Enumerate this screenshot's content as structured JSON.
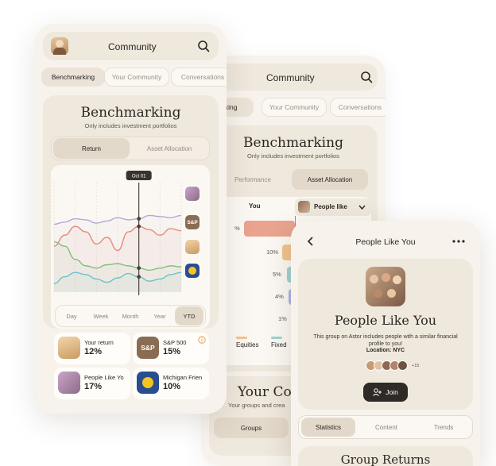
{
  "back": {
    "header": {
      "title": "Community"
    },
    "tabs": [
      {
        "label": "hmarking"
      },
      {
        "label": "Your Community"
      },
      {
        "label": "Conversations"
      }
    ],
    "section": {
      "title": "Benchmarking",
      "subtitle": "Only includes investment portfolios",
      "segments": [
        {
          "label": "Performance"
        },
        {
          "label": "Asset Allocation"
        }
      ]
    },
    "compare": {
      "left_label": "You",
      "right_label": "People like"
    },
    "bars": [
      {
        "pct": "%",
        "color": "#e9a38f"
      },
      {
        "pct": "10%",
        "color": "#f2c38f"
      },
      {
        "pct": "5%",
        "color": "#9fd4d0"
      },
      {
        "pct": "4%",
        "color": "#a9b7e4"
      },
      {
        "pct": "1%",
        "color": "#d9a8c6"
      }
    ],
    "legend": [
      {
        "label": "F",
        "color": "#f2c38f"
      },
      {
        "label": "Equities",
        "color": "#f2c38f"
      },
      {
        "label": "Fixed",
        "color": "#9fd4d0"
      }
    ],
    "community": {
      "title": "Your Co",
      "subtitle": "Your groups and crea",
      "button": "Groups"
    }
  },
  "front": {
    "header": {
      "title": "Community"
    },
    "tabs": [
      {
        "label": "Benchmarking"
      },
      {
        "label": "Your Community"
      },
      {
        "label": "Conversations"
      }
    ],
    "section": {
      "title": "Benchmarking",
      "subtitle": "Only includes investment portfolios",
      "segments": [
        {
          "label": "Return"
        },
        {
          "label": "Asset Allocation"
        }
      ]
    },
    "chart_data": {
      "type": "line",
      "title": "",
      "xlabel": "",
      "ylabel": "",
      "x": [
        0,
        1,
        2,
        3,
        4,
        5,
        6,
        7,
        8,
        9,
        10,
        11,
        12
      ],
      "ylim": [
        0,
        100
      ],
      "marker_label": "Oct 01",
      "grid": true,
      "series": [
        {
          "color": "#b9a4dc",
          "values": [
            62,
            64,
            67,
            66,
            63,
            65,
            68,
            66,
            67,
            70,
            69,
            68,
            70
          ]
        },
        {
          "color": "#e58a7a",
          "values": [
            42,
            52,
            60,
            55,
            44,
            50,
            38,
            55,
            60,
            57,
            52,
            58,
            56
          ]
        },
        {
          "color": "#7fbf7b",
          "values": [
            46,
            42,
            30,
            24,
            22,
            25,
            26,
            24,
            22,
            20,
            22,
            24,
            23
          ]
        },
        {
          "color": "#6ec2c6",
          "values": [
            8,
            14,
            18,
            16,
            12,
            9,
            13,
            17,
            14,
            10,
            12,
            16,
            18
          ]
        }
      ]
    },
    "timeframes": [
      {
        "label": "Day"
      },
      {
        "label": "Week"
      },
      {
        "label": "Month"
      },
      {
        "label": "Year"
      },
      {
        "label": "YTD"
      }
    ],
    "tiles": [
      {
        "label": "Your return",
        "value": "12%"
      },
      {
        "label": "S&P 500",
        "value": "15%",
        "badge": "S&P"
      },
      {
        "label": "People Like Yo",
        "value": "17%"
      },
      {
        "label": "Michigan Frien",
        "value": "10%"
      }
    ],
    "sp_badge": "S&P"
  },
  "right": {
    "header": {
      "title": "People Like You"
    },
    "group": {
      "title": "People Like You",
      "description": "This group on Astor includes people with a similar financial profile to you!",
      "location": "Location: NYC",
      "member_count": "+15",
      "join_label": "Join"
    },
    "tabs": [
      {
        "label": "Statistics"
      },
      {
        "label": "Content"
      },
      {
        "label": "Trends"
      }
    ],
    "returns_title": "Group Returns"
  }
}
